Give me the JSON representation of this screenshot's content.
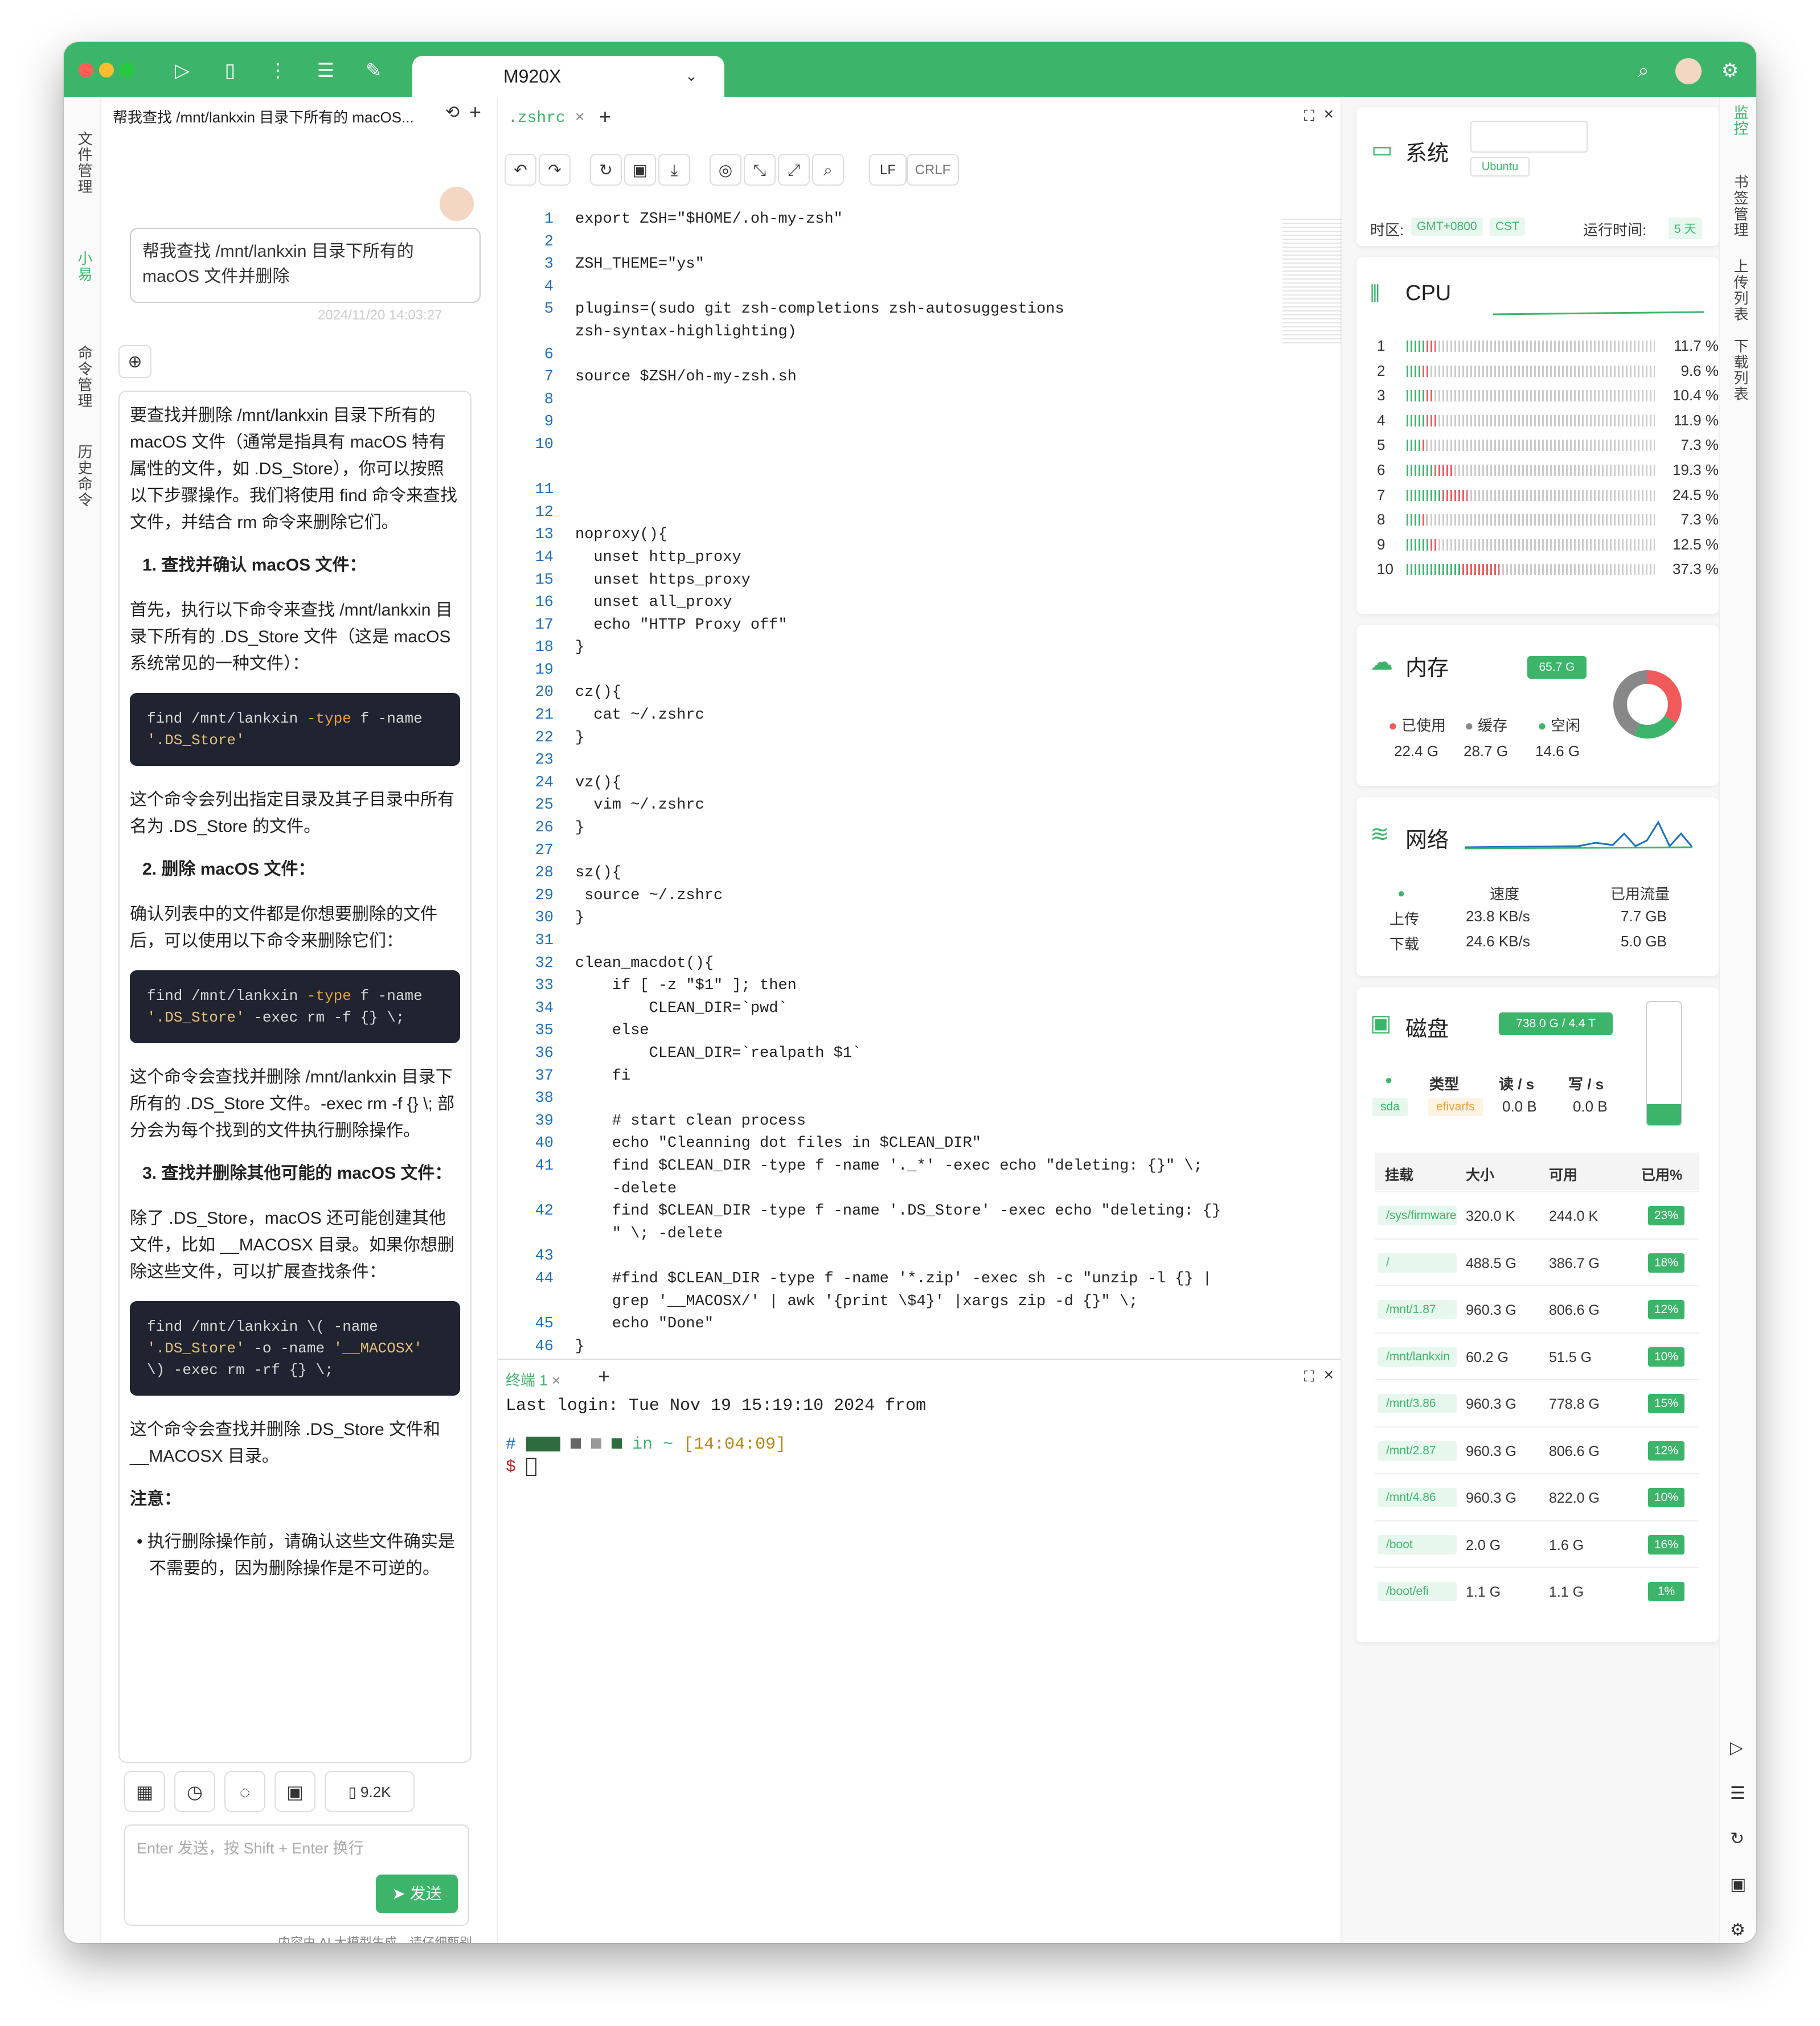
{
  "window": {
    "active_tab": "M920X"
  },
  "left_rail": {
    "items": [
      "文件管理",
      "小易",
      "命令管理",
      "历史命令"
    ]
  },
  "right_rail": {
    "items": [
      "监控",
      "书签管理",
      "上传列表",
      "下载列表"
    ]
  },
  "chat": {
    "title": "帮我查找 /mnt/lankxin 目录下所有的 macOS...",
    "user_message_line1": "帮我查找 /mnt/lankxin 目录下所有的",
    "user_message_line2": "macOS 文件并删除",
    "timestamp": "2024/11/20 14:03:27",
    "answer": {
      "intro": "要查找并删除 /mnt/lankxin 目录下所有的 macOS 文件（通常是指具有 macOS 特有属性的文件，如 .DS_Store），你可以按照以下步骤操作。我们将使用 find 命令来查找文件，并结合 rm 命令来删除它们。",
      "step1_title": "1. 查找并确认 macOS 文件：",
      "step1_text": "首先，执行以下命令来查找 /mnt/lankxin 目录下所有的 .DS_Store 文件（这是 macOS 系统常见的一种文件）：",
      "code1_a": "find /mnt/lankxin ",
      "code1_b": "-type",
      "code1_c": " f -name",
      "code1_d": "'.DS_Store'",
      "after_code1": "这个命令会列出指定目录及其子目录中所有名为 .DS_Store 的文件。",
      "step2_title": "2. 删除 macOS 文件：",
      "step2_text": "确认列表中的文件都是你想要删除的文件后，可以使用以下命令来删除它们：",
      "code2_a": "find /mnt/lankxin ",
      "code2_b": "-type",
      "code2_c": " f -name",
      "code2_d": "'.DS_Store'",
      "code2_e": " -exec rm -f {} \\;",
      "after_code2": "这个命令会查找并删除 /mnt/lankxin 目录下所有的 .DS_Store 文件。-exec rm -f {} \\; 部分会为每个找到的文件执行删除操作。",
      "step3_title": "3. 查找并删除其他可能的 macOS 文件：",
      "step3_text": "除了 .DS_Store，macOS 还可能创建其他文件，比如 __MACOSX 目录。如果你想删除这些文件，可以扩展查找条件：",
      "code3_l1": "find /mnt/lankxin \\( -name",
      "code3_l2a": "'.DS_Store'",
      "code3_l2b": " -o -name ",
      "code3_l2c": "'__MACOSX'",
      "code3_l3": "\\) -exec rm -rf {} \\;",
      "after_code3": "这个命令会查找并删除 .DS_Store 文件和 __MACOSX 目录。",
      "note_title": "注意：",
      "note_item": "执行删除操作前，请确认这些文件确实是不需要的，因为删除操作是不可逆的。"
    },
    "token_count": "9.2K",
    "input_placeholder": "Enter 发送，按 Shift + Enter 换行",
    "send_label": "发送",
    "disclaimer": "内容由 AI 大模型生成，请仔细甄别"
  },
  "editor": {
    "file_tab": ".zshrc",
    "line_ending_lf": "LF",
    "line_ending_crlf": "CRLF",
    "lines": [
      {
        "n": "1",
        "t": "export ZSH=\"$HOME/.oh-my-zsh\""
      },
      {
        "n": "2",
        "t": ""
      },
      {
        "n": "3",
        "t": "ZSH_THEME=\"ys\""
      },
      {
        "n": "4",
        "t": ""
      },
      {
        "n": "5",
        "t": "plugins=(sudo git zsh-completions zsh-autosuggestions"
      },
      {
        "n": "",
        "t": "zsh-syntax-highlighting)"
      },
      {
        "n": "6",
        "t": ""
      },
      {
        "n": "7",
        "t": "source $ZSH/oh-my-zsh.sh"
      },
      {
        "n": "8",
        "t": ""
      },
      {
        "n": "9",
        "t": ""
      },
      {
        "n": "10",
        "t": ""
      },
      {
        "n": "",
        "t": ""
      },
      {
        "n": "11",
        "t": ""
      },
      {
        "n": "12",
        "t": ""
      },
      {
        "n": "13",
        "t": "noproxy(){"
      },
      {
        "n": "14",
        "t": "  unset http_proxy"
      },
      {
        "n": "15",
        "t": "  unset https_proxy"
      },
      {
        "n": "16",
        "t": "  unset all_proxy"
      },
      {
        "n": "17",
        "t": "  echo \"HTTP Proxy off\""
      },
      {
        "n": "18",
        "t": "}"
      },
      {
        "n": "19",
        "t": ""
      },
      {
        "n": "20",
        "t": "cz(){"
      },
      {
        "n": "21",
        "t": "  cat ~/.zshrc"
      },
      {
        "n": "22",
        "t": "}"
      },
      {
        "n": "23",
        "t": ""
      },
      {
        "n": "24",
        "t": "vz(){"
      },
      {
        "n": "25",
        "t": "  vim ~/.zshrc"
      },
      {
        "n": "26",
        "t": "}"
      },
      {
        "n": "27",
        "t": ""
      },
      {
        "n": "28",
        "t": "sz(){"
      },
      {
        "n": "29",
        "t": " source ~/.zshrc"
      },
      {
        "n": "30",
        "t": "}"
      },
      {
        "n": "31",
        "t": ""
      },
      {
        "n": "32",
        "t": "clean_macdot(){"
      },
      {
        "n": "33",
        "t": "    if [ -z \"$1\" ]; then"
      },
      {
        "n": "34",
        "t": "        CLEAN_DIR=`pwd`"
      },
      {
        "n": "35",
        "t": "    else"
      },
      {
        "n": "36",
        "t": "        CLEAN_DIR=`realpath $1`"
      },
      {
        "n": "37",
        "t": "    fi"
      },
      {
        "n": "38",
        "t": ""
      },
      {
        "n": "39",
        "t": "    # start clean process"
      },
      {
        "n": "40",
        "t": "    echo \"Cleanning dot files in $CLEAN_DIR\""
      },
      {
        "n": "41",
        "t": "    find $CLEAN_DIR -type f -name '._*' -exec echo \"deleting: {}\" \\;"
      },
      {
        "n": "",
        "t": "    -delete"
      },
      {
        "n": "42",
        "t": "    find $CLEAN_DIR -type f -name '.DS_Store' -exec echo \"deleting: {}"
      },
      {
        "n": "",
        "t": "    \" \\; -delete"
      },
      {
        "n": "43",
        "t": ""
      },
      {
        "n": "44",
        "t": "    #find $CLEAN_DIR -type f -name '*.zip' -exec sh -c \"unzip -l {} |"
      },
      {
        "n": "",
        "t": "    grep '__MACOSX/' | awk '{print \\$4}' |xargs zip -d {}\" \\;"
      },
      {
        "n": "45",
        "t": "    echo \"Done\""
      },
      {
        "n": "46",
        "t": "}"
      },
      {
        "n": "47",
        "t": ""
      }
    ]
  },
  "terminal": {
    "tab_label": "终端",
    "tab_index": "1",
    "last_login": "Last login: Tue Nov 19 15:19:10 2024 from",
    "prompt_in": "in ~",
    "prompt_time": "[14:04:09]",
    "prompt_symbol": "$"
  },
  "monitor": {
    "system": {
      "title": "系统",
      "os": "Ubuntu",
      "timezone_label": "时区:",
      "timezone": "GMT+0800",
      "tz_abbr": "CST",
      "uptime_label": "运行时间:",
      "uptime": "5 天"
    },
    "cpu": {
      "title": "CPU",
      "cores": [
        {
          "id": "1",
          "pct": "11.7 %",
          "value": 11.7
        },
        {
          "id": "2",
          "pct": "9.6 %",
          "value": 9.6
        },
        {
          "id": "3",
          "pct": "10.4 %",
          "value": 10.4
        },
        {
          "id": "4",
          "pct": "11.9 %",
          "value": 11.9
        },
        {
          "id": "5",
          "pct": "7.3 %",
          "value": 7.3
        },
        {
          "id": "6",
          "pct": "19.3 %",
          "value": 19.3
        },
        {
          "id": "7",
          "pct": "24.5 %",
          "value": 24.5
        },
        {
          "id": "8",
          "pct": "7.3 %",
          "value": 7.3
        },
        {
          "id": "9",
          "pct": "12.5 %",
          "value": 12.5
        },
        {
          "id": "10",
          "pct": "37.3 %",
          "value": 37.3
        }
      ]
    },
    "memory": {
      "title": "内存",
      "total": "65.7 G",
      "used_label": "已使用",
      "cache_label": "缓存",
      "free_label": "空闲",
      "used": "22.4 G",
      "cache": "28.7 G",
      "free": "14.6 G",
      "used_value": 22.4,
      "cache_value": 28.7,
      "free_value": 14.6,
      "colors": {
        "used": "#f05a5a",
        "cache": "#888888",
        "free": "#3cb56a"
      }
    },
    "network": {
      "title": "网络",
      "speed_label": "速度",
      "traffic_label": "已用流量",
      "up_label": "上传",
      "down_label": "下载",
      "up_speed": "23.8 KB/s",
      "down_speed": "24.6 KB/s",
      "up_traffic": "7.7 GB",
      "down_traffic": "5.0 GB"
    },
    "disk": {
      "title": "磁盘",
      "total": "738.0 G / 4.4 T",
      "type_label": "类型",
      "read_label": "读 / s",
      "write_label": "写 / s",
      "device": "sda",
      "fs": "efivarfs",
      "read": "0.0 B",
      "write": "0.0 B",
      "fill_value": 0.17,
      "col_mount": "挂载",
      "col_size": "大小",
      "col_avail": "可用",
      "col_used": "已用%",
      "rows": [
        {
          "mount": "/sys/firmware",
          "size": "320.0 K",
          "avail": "244.0 K",
          "used": "23%"
        },
        {
          "mount": "/",
          "size": "488.5 G",
          "avail": "386.7 G",
          "used": "18%"
        },
        {
          "mount": "/mnt/1.87",
          "size": "960.3 G",
          "avail": "806.6 G",
          "used": "12%"
        },
        {
          "mount": "/mnt/lankxin",
          "size": "60.2 G",
          "avail": "51.5 G",
          "used": "10%"
        },
        {
          "mount": "/mnt/3.86",
          "size": "960.3 G",
          "avail": "778.8 G",
          "used": "15%"
        },
        {
          "mount": "/mnt/2.87",
          "size": "960.3 G",
          "avail": "806.6 G",
          "used": "12%"
        },
        {
          "mount": "/mnt/4.86",
          "size": "960.3 G",
          "avail": "822.0 G",
          "used": "10%"
        },
        {
          "mount": "/boot",
          "size": "2.0 G",
          "avail": "1.6 G",
          "used": "16%"
        },
        {
          "mount": "/boot/efi",
          "size": "1.1 G",
          "avail": "1.1 G",
          "used": "1%"
        }
      ]
    }
  }
}
